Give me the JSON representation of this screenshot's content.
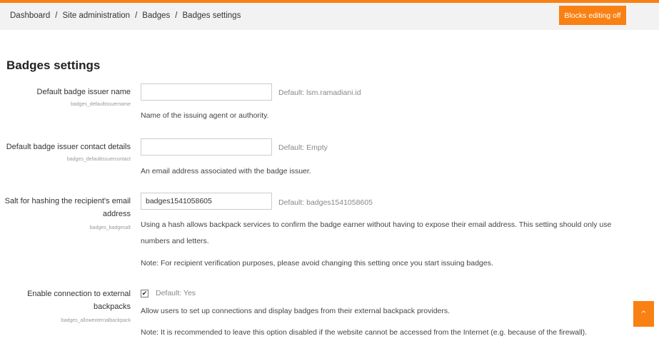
{
  "breadcrumb": {
    "items": [
      "Dashboard",
      "Site administration",
      "Badges",
      "Badges settings"
    ],
    "separator": "/"
  },
  "header": {
    "blocks_button_label": "Blocks editing off"
  },
  "page": {
    "title": "Badges settings"
  },
  "settings": {
    "issuer_name": {
      "label": "Default badge issuer name",
      "key": "badges_defaultissuername",
      "value": "",
      "default": "Default: lsm.ramadiani.id",
      "description": "Name of the issuing agent or authority."
    },
    "issuer_contact": {
      "label": "Default badge issuer contact details",
      "key": "badges_defaultissuercontact",
      "value": "",
      "default": "Default: Empty",
      "description": "An email address associated with the badge issuer."
    },
    "salt": {
      "label_line1": "Salt for hashing the recipient's email",
      "label_line2": "address",
      "key": "badges_badgesalt",
      "value": "badges1541058605",
      "default": "Default: badges1541058605",
      "description_line1": "Using a hash allows backpack services to confirm the badge earner without having to expose their email address. This setting should only use",
      "description_line2": "numbers and letters.",
      "note": "Note: For recipient verification purposes, please avoid changing this setting once you start issuing badges."
    },
    "external_backpack": {
      "label_line1": "Enable connection to external",
      "label_line2": "backpacks",
      "key": "badges_allowexternalbackpack",
      "checked": true,
      "check_glyph": "✔",
      "default": "Default: Yes",
      "description": "Allow users to set up connections and display badges from their external backpack providers.",
      "note": "Note: It is recommended to leave this option disabled if the website cannot be accessed from the Internet (e.g. because of the firewall)."
    }
  },
  "scroll_top": {
    "icon": "chevron-up-icon",
    "glyph": "^"
  },
  "colors": {
    "accent": "#f98012",
    "navbar_bg": "#f2f2f2"
  }
}
